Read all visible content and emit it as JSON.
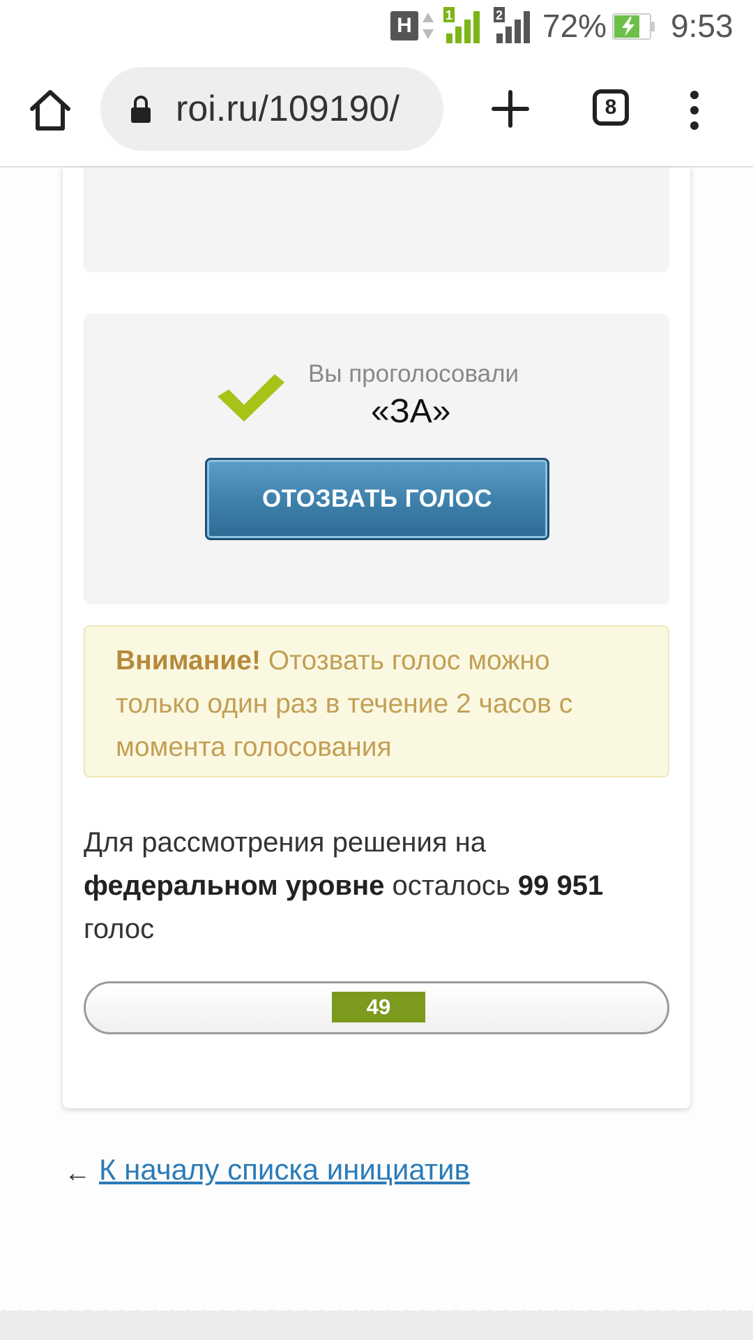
{
  "status_bar": {
    "network_letter": "H",
    "sim1": "1",
    "sim2": "2",
    "battery_percent": "72%",
    "time": "9:53"
  },
  "browser": {
    "url": "roi.ru/109190/",
    "tabs_count": "8"
  },
  "vote": {
    "label": "Вы проголосовали",
    "value": "«ЗА»",
    "revoke_button": "ОТОЗВАТЬ ГОЛОС"
  },
  "warning": {
    "title": "Внимание!",
    "text": "Отозвать голос можно только один раз в течение 2 часов с момента голосования"
  },
  "remaining": {
    "prefix": "Для рассмотрения решения на ",
    "level": "федеральном уровне",
    "middle": " осталось ",
    "count": "99 951",
    "suffix": " голос"
  },
  "progress": {
    "label": "49"
  },
  "back_link": {
    "arrow": "←",
    "label": "К началу списка инициатив"
  },
  "colors": {
    "accent_green": "#7c9a1e",
    "check_green": "#a8c218",
    "button_blue": "#3f82ac",
    "link_blue": "#2b7bb8",
    "warning_text": "#c29f55"
  }
}
